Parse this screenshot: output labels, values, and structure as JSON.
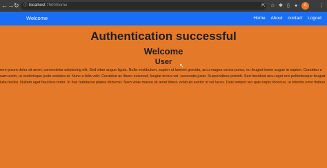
{
  "browser": {
    "url_host": "localhost",
    "url_path": ":7500/home",
    "avatar_letter": "A"
  },
  "navbar": {
    "brand": "Welcome",
    "links": [
      "Home",
      "About",
      "contact",
      "Logout"
    ]
  },
  "main": {
    "title": "Authentication successful",
    "welcome": "Welcome",
    "user": "User",
    "paragraph": "orem ipsum dolor sit amet, consectetur adipiscing elit. Sed vitae augue ligula. Nulla vestibulum, sapien ut laoreet gravida, arcu magna varius purus, eu feugiat lorem augue in sapien. Curabitur n quam enim, ut scelerisque justo sodales at. Nunc a felis velit. Curabitur ac libero euismod, feugiat lectus vel, venenatis justo. Suspendisse potenti. Sed tincidunt arcu eget orci pellentesque feugiat. Nulla facilisi. Nullam eget faucibus tortor. In hac habitasse platea dictumst. Nam vitae massa sit amet libero vehicula auctor id vel lacus. Duis tempor leo quis turpis rhoncus, ut lobortis ortor finibus."
  },
  "colors": {
    "page_bg": "#e5792a",
    "navbar_bg": "#1a6ef5"
  }
}
